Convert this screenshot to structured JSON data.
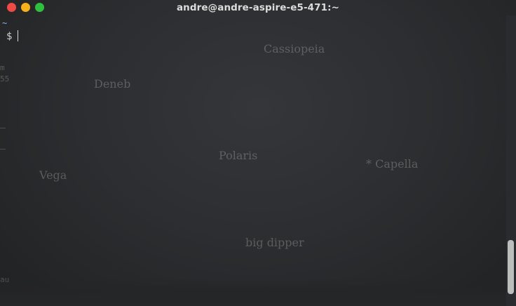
{
  "window": {
    "title": "andre@andre-aspire-e5-471:~"
  },
  "terminal": {
    "cwd": "~",
    "prompt": "$"
  },
  "background_labels": {
    "cassiopeia": "Cassiopeia",
    "deneb": "Deneb",
    "polaris": "Polaris",
    "capella": "* Capella",
    "vega": "Vega",
    "big_dipper": "big dipper"
  },
  "left_edge_fragments": {
    "a": "m",
    "b": "55",
    "c": "au"
  },
  "colors": {
    "close": "#ee4b47",
    "minimize": "#f5b11b",
    "zoom": "#2fc13e"
  }
}
